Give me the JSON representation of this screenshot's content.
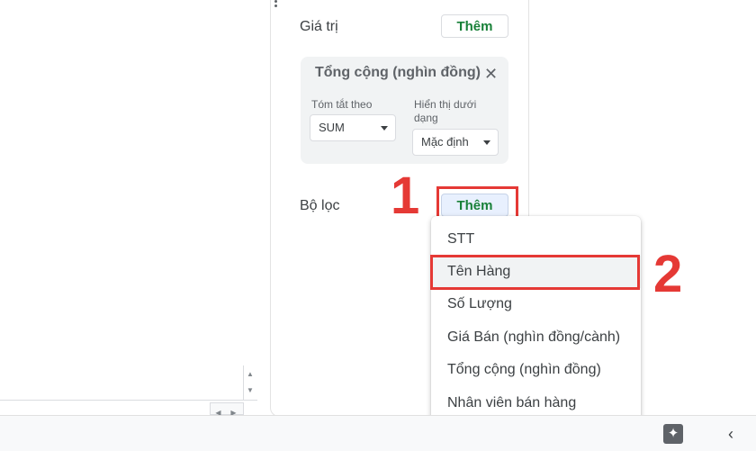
{
  "panel": {
    "values": {
      "label": "Giá trị",
      "add_label": "Thêm",
      "card": {
        "title": "Tổng cộng (nghìn đồng)",
        "close_icon": "close-icon",
        "summarize_label": "Tóm tắt theo",
        "summarize_value": "SUM",
        "show_as_label_line1": "Hiển thị dưới",
        "show_as_label_line2": "dạng",
        "show_as_value": "Mặc định"
      }
    },
    "filters": {
      "label": "Bộ lọc",
      "add_label": "Thêm"
    }
  },
  "dropdown": {
    "items": [
      {
        "label": "STT"
      },
      {
        "label": "Tên Hàng"
      },
      {
        "label": "Số Lượng"
      },
      {
        "label": "Giá Bán (nghìn đồng/cành)"
      },
      {
        "label": "Tổng cộng (nghìn đồng)"
      },
      {
        "label": "Nhân viên bán hàng"
      }
    ],
    "highlighted_index": 1
  },
  "annotations": {
    "step1": "1",
    "step2": "2",
    "color": "#e53935"
  },
  "bottom_bar": {
    "explore_icon": "explore-sparkle-icon",
    "collapse_icon": "chevron-left-icon"
  },
  "colors": {
    "add_text": "#188038",
    "card_bg": "#f1f3f4",
    "active_add_bg": "#e8f0fe"
  }
}
